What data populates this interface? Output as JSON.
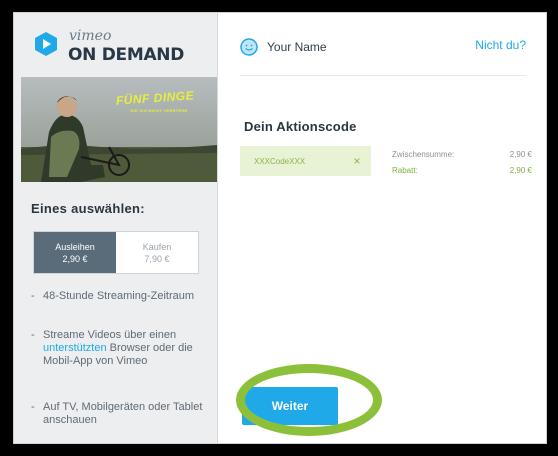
{
  "brand": {
    "vimeo": "vimeo",
    "on_demand": "ON DEMAND",
    "logo_color": "#1fa9e8"
  },
  "poster": {
    "title": "FÜNF DINGE",
    "subtitle": "DIE ICH NICHT VERSTEHE"
  },
  "choose_heading": "Eines auswählen:",
  "options": [
    {
      "label": "Ausleihen",
      "price": "2,90 €",
      "selected": true
    },
    {
      "label": "Kaufen",
      "price": "7,90 €",
      "selected": false
    }
  ],
  "features": [
    {
      "dash": "-",
      "text": "48-Stunde Streaming-Zeitraum"
    },
    {
      "dash": "-",
      "before": "Streame Videos über einen ",
      "link": "unterstützten",
      "after": " Browser oder die Mobil-App von Vimeo"
    },
    {
      "dash": "-",
      "text": "Auf TV, Mobilgeräten oder Tablet anschauen"
    }
  ],
  "user": {
    "name": "Your Name",
    "not_you": "Nicht du?"
  },
  "promo": {
    "title": "Dein Aktionscode",
    "code": "XXXCodeXXX",
    "remove_glyph": "×"
  },
  "summary": {
    "subtotal_label": "Zwischensumme:",
    "subtotal_value": "2,90 €",
    "discount_label": "Rabatt:",
    "discount_value": "2,90 €"
  },
  "continue_label": "Weiter",
  "colors": {
    "accent": "#1fa9e8",
    "highlight": "#8cc03a",
    "discount": "#7fb13c"
  }
}
